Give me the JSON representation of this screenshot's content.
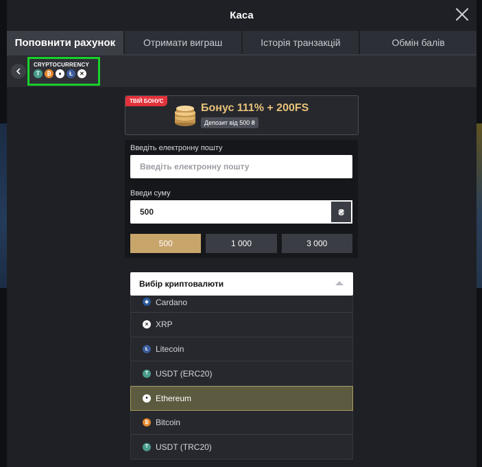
{
  "modal": {
    "title": "Каса"
  },
  "tabs": [
    {
      "label": "Поповнити рахунок",
      "active": true
    },
    {
      "label": "Отримати виграш",
      "active": false
    },
    {
      "label": "Історія транзакцій",
      "active": false
    },
    {
      "label": "Обмін балів",
      "active": false
    }
  ],
  "method_chip": {
    "label": "CRYPTOCURRENCY",
    "icons": [
      "tether-icon",
      "bitcoin-icon",
      "ethereum-icon",
      "litecoin-icon",
      "xrp-icon"
    ]
  },
  "bonus": {
    "badge": "ТВІЙ БОНУС",
    "title": "Бонус 111% + 200FS",
    "deposit_note": "Депозит від 500 ₴"
  },
  "form": {
    "email_label": "Введіть електронну пошту",
    "email_placeholder": "Введіть електронну пошту",
    "amount_label": "Введи суму",
    "amount_value": "500",
    "currency_symbol": "₴",
    "presets": [
      {
        "label": "500",
        "active": true
      },
      {
        "label": "1 000",
        "active": false
      },
      {
        "label": "3 000",
        "active": false
      }
    ]
  },
  "crypto_select": {
    "title": "Вибір криптовалюти",
    "options": [
      {
        "label": "Cardano",
        "icon": "cardano-icon",
        "color": "#2a5a9a",
        "glyph": "◈"
      },
      {
        "label": "XRP",
        "icon": "xrp-icon",
        "color": "#ffffff",
        "glyph": "✕"
      },
      {
        "label": "Litecoin",
        "icon": "litecoin-icon",
        "color": "#3c5c9c",
        "glyph": "Ł"
      },
      {
        "label": "USDT (ERC20)",
        "icon": "tether-icon",
        "color": "#4a9c8c",
        "glyph": "T"
      },
      {
        "label": "Ethereum",
        "icon": "ethereum-icon",
        "color": "#ffffff",
        "glyph": "♦",
        "selected": true
      },
      {
        "label": "Bitcoin",
        "icon": "bitcoin-icon",
        "color": "#e6862c",
        "glyph": "₿"
      },
      {
        "label": "USDT (TRC20)",
        "icon": "tether-icon",
        "color": "#4a9c8c",
        "glyph": "T"
      }
    ]
  },
  "colors": {
    "accent_gold": "#c8a56b",
    "chip_highlight": "#19d12a",
    "bonus_badge": "#e2323a",
    "selected_option": "#5c5a3f"
  }
}
